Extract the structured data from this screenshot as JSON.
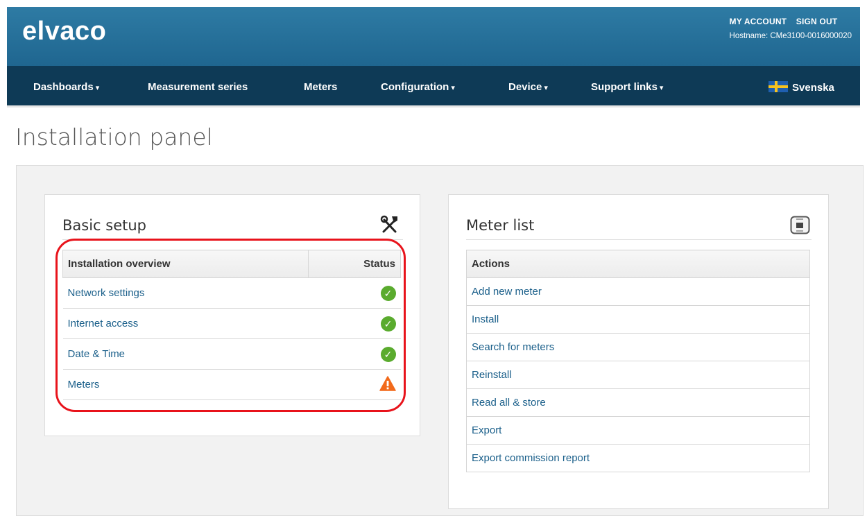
{
  "header": {
    "logo": "elvaco",
    "my_account": "MY ACCOUNT",
    "sign_out": "SIGN OUT",
    "hostname": "Hostname: CMe3100-0016000020"
  },
  "nav": {
    "dashboards": "Dashboards",
    "measurement_series": "Measurement series",
    "meters": "Meters",
    "configuration": "Configuration",
    "device": "Device",
    "support_links": "Support links",
    "language": "Svenska",
    "caret": "▾"
  },
  "page": {
    "title": "Installation panel"
  },
  "basic_setup": {
    "title": "Basic setup",
    "icon": "tools-icon",
    "col_overview": "Installation overview",
    "col_status": "Status",
    "rows": [
      {
        "label": "Network settings",
        "status": "ok"
      },
      {
        "label": "Internet access",
        "status": "ok"
      },
      {
        "label": "Date & Time",
        "status": "ok"
      },
      {
        "label": "Meters",
        "status": "warning"
      }
    ]
  },
  "meter_list": {
    "title": "Meter list",
    "icon": "meter-icon",
    "col_actions": "Actions",
    "actions": [
      "Add new meter",
      "Install",
      "Search for meters",
      "Reinstall",
      "Read all & store",
      "Export",
      "Export commission report"
    ]
  },
  "colors": {
    "header_blue": "#2677a0",
    "nav_dark": "#0e3a56",
    "link": "#1a5f8a",
    "ok_green": "#5aab2e",
    "warn_orange": "#f26a1b",
    "highlight_red": "#e8131b"
  }
}
